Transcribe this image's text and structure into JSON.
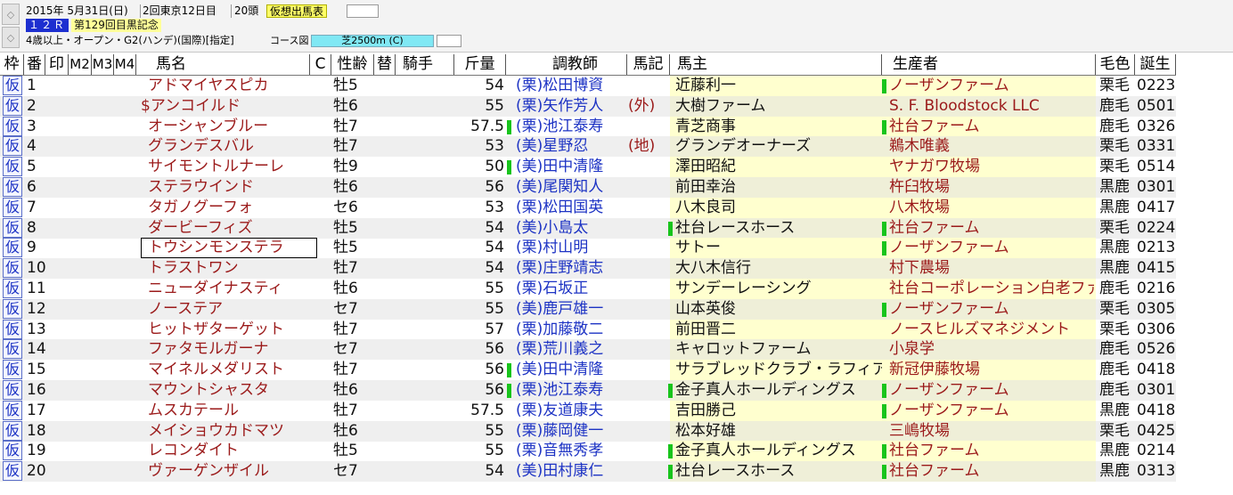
{
  "header": {
    "date": "2015年 5月31日(日)",
    "meeting": "2回東京12日目",
    "runners": "20頭",
    "mode_button": "仮想出馬表",
    "race_no": "１２Ｒ",
    "race_name": "第129回目黒記念",
    "conditions": "4歳以上・オープン・G2(ハンデ)(国際)[指定]",
    "course_label": "コース図",
    "course_value": "芝2500m (C)",
    "nav_up": "◇",
    "nav_down": "◇"
  },
  "columns": {
    "waku": "枠",
    "ban": "番",
    "shirushi": "印",
    "m2": "M2",
    "m3": "M3",
    "m4": "M4",
    "horse": "馬名",
    "c": "C",
    "sexage": "性齢",
    "kae": "替",
    "jockey": "騎手",
    "kinryo": "斤量",
    "trainer": "調教師",
    "umaki": "馬記",
    "owner": "馬主",
    "breeder": "生産者",
    "keiro": "毛色",
    "birth": "誕生"
  },
  "rows": [
    {
      "waku": "仮",
      "no": "1",
      "horse": "アドマイヤスピカ",
      "sexage": "牡5",
      "kinryo": "54",
      "trainer": "(栗)松田博資",
      "umaki": "",
      "owner": "近藤利一",
      "breeder": "ノーザンファーム",
      "keiro": "栗毛",
      "birth": "0223",
      "trainer_mark": false,
      "owner_mark": false,
      "breeder_mark": true,
      "breeder_color": "normal"
    },
    {
      "waku": "仮",
      "no": "2",
      "horse": "$アンコイルド",
      "sexage": "牡6",
      "kinryo": "55",
      "trainer": "(栗)矢作芳人",
      "umaki": "(外)",
      "owner": "大樹ファーム",
      "breeder": "S. F. Bloodstock LLC",
      "keiro": "鹿毛",
      "birth": "0501",
      "trainer_mark": false,
      "owner_mark": false,
      "breeder_mark": false,
      "breeder_color": "normal"
    },
    {
      "waku": "仮",
      "no": "3",
      "horse": "オーシャンブルー",
      "sexage": "牡7",
      "kinryo": "57.5",
      "trainer": "(栗)池江泰寿",
      "umaki": "",
      "owner": "青芝商事",
      "breeder": "社台ファーム",
      "keiro": "鹿毛",
      "birth": "0326",
      "trainer_mark": true,
      "owner_mark": false,
      "breeder_mark": true,
      "breeder_color": "normal"
    },
    {
      "waku": "仮",
      "no": "4",
      "horse": "グランデスバル",
      "sexage": "牡7",
      "kinryo": "53",
      "trainer": "(美)星野忍",
      "umaki": "(地)",
      "owner": "グランデオーナーズ",
      "breeder": "鵜木唯義",
      "keiro": "栗毛",
      "birth": "0331",
      "trainer_mark": false,
      "owner_mark": false,
      "breeder_mark": false,
      "breeder_color": "normal"
    },
    {
      "waku": "仮",
      "no": "5",
      "horse": "サイモントルナーレ",
      "sexage": "牡9",
      "kinryo": "50",
      "trainer": "(美)田中清隆",
      "umaki": "",
      "owner": "澤田昭紀",
      "breeder": "ヤナガワ牧場",
      "keiro": "栗毛",
      "birth": "0514",
      "trainer_mark": true,
      "owner_mark": false,
      "breeder_mark": false,
      "breeder_color": "normal"
    },
    {
      "waku": "仮",
      "no": "6",
      "horse": "ステラウインド",
      "sexage": "牡6",
      "kinryo": "56",
      "trainer": "(美)尾関知人",
      "umaki": "",
      "owner": "前田幸治",
      "breeder": "杵臼牧場",
      "keiro": "黒鹿",
      "birth": "0301",
      "trainer_mark": false,
      "owner_mark": false,
      "breeder_mark": false,
      "breeder_color": "normal"
    },
    {
      "waku": "仮",
      "no": "7",
      "horse": "タガノグーフォ",
      "sexage": "セ6",
      "kinryo": "53",
      "trainer": "(栗)松田国英",
      "umaki": "",
      "owner": "八木良司",
      "breeder": "八木牧場",
      "keiro": "黒鹿",
      "birth": "0417",
      "trainer_mark": false,
      "owner_mark": false,
      "breeder_mark": false,
      "breeder_color": "normal"
    },
    {
      "waku": "仮",
      "no": "8",
      "horse": "ダービーフィズ",
      "sexage": "牡5",
      "kinryo": "54",
      "trainer": "(美)小島太",
      "umaki": "",
      "owner": "社台レースホース",
      "breeder": "社台ファーム",
      "keiro": "栗毛",
      "birth": "0224",
      "trainer_mark": false,
      "owner_mark": true,
      "breeder_mark": true,
      "breeder_color": "normal"
    },
    {
      "waku": "仮",
      "no": "9",
      "horse": "トウシンモンステラ",
      "sexage": "牡5",
      "kinryo": "54",
      "trainer": "(栗)村山明",
      "umaki": "",
      "owner": "サトー",
      "breeder": "ノーザンファーム",
      "keiro": "黒鹿",
      "birth": "0213",
      "trainer_mark": false,
      "owner_mark": false,
      "breeder_mark": true,
      "breeder_color": "normal"
    },
    {
      "waku": "仮",
      "no": "10",
      "horse": "トラストワン",
      "sexage": "牡7",
      "kinryo": "54",
      "trainer": "(栗)庄野靖志",
      "umaki": "",
      "owner": "大八木信行",
      "breeder": "村下農場",
      "keiro": "黒鹿",
      "birth": "0415",
      "trainer_mark": false,
      "owner_mark": false,
      "breeder_mark": false,
      "breeder_color": "normal"
    },
    {
      "waku": "仮",
      "no": "11",
      "horse": "ニューダイナスティ",
      "sexage": "牡6",
      "kinryo": "55",
      "trainer": "(栗)石坂正",
      "umaki": "",
      "owner": "サンデーレーシング",
      "breeder": "社台コーポレーション白老ファー",
      "keiro": "鹿毛",
      "birth": "0216",
      "trainer_mark": false,
      "owner_mark": false,
      "breeder_mark": false,
      "breeder_color": "normal"
    },
    {
      "waku": "仮",
      "no": "12",
      "horse": "ノーステア",
      "sexage": "セ7",
      "kinryo": "55",
      "trainer": "(美)鹿戸雄一",
      "umaki": "",
      "owner": "山本英俊",
      "breeder": "ノーザンファーム",
      "keiro": "栗毛",
      "birth": "0305",
      "trainer_mark": false,
      "owner_mark": false,
      "breeder_mark": true,
      "breeder_color": "normal"
    },
    {
      "waku": "仮",
      "no": "13",
      "horse": "ヒットザターゲット",
      "sexage": "牡7",
      "kinryo": "57",
      "trainer": "(栗)加藤敬二",
      "umaki": "",
      "owner": "前田晋二",
      "breeder": "ノースヒルズマネジメント",
      "keiro": "栗毛",
      "birth": "0306",
      "trainer_mark": false,
      "owner_mark": false,
      "breeder_mark": false,
      "breeder_color": "normal"
    },
    {
      "waku": "仮",
      "no": "14",
      "horse": "ファタモルガーナ",
      "sexage": "セ7",
      "kinryo": "56",
      "trainer": "(栗)荒川義之",
      "umaki": "",
      "owner": "キャロットファーム",
      "breeder": "小泉学",
      "keiro": "鹿毛",
      "birth": "0526",
      "trainer_mark": false,
      "owner_mark": false,
      "breeder_mark": false,
      "breeder_color": "normal"
    },
    {
      "waku": "仮",
      "no": "15",
      "horse": "マイネルメダリスト",
      "sexage": "牡7",
      "kinryo": "56",
      "trainer": "(美)田中清隆",
      "umaki": "",
      "owner": "サラブレッドクラブ・ラフィアン",
      "breeder": "新冠伊藤牧場",
      "keiro": "鹿毛",
      "birth": "0418",
      "trainer_mark": true,
      "owner_mark": false,
      "breeder_mark": false,
      "breeder_color": "normal"
    },
    {
      "waku": "仮",
      "no": "16",
      "horse": "マウントシャスタ",
      "sexage": "牡6",
      "kinryo": "56",
      "trainer": "(栗)池江泰寿",
      "umaki": "",
      "owner": "金子真人ホールディングス",
      "breeder": "ノーザンファーム",
      "keiro": "鹿毛",
      "birth": "0301",
      "trainer_mark": true,
      "owner_mark": true,
      "breeder_mark": true,
      "breeder_color": "normal"
    },
    {
      "waku": "仮",
      "no": "17",
      "horse": "ムスカテール",
      "sexage": "牡7",
      "kinryo": "57.5",
      "trainer": "(栗)友道康夫",
      "umaki": "",
      "owner": "吉田勝己",
      "breeder": "ノーザンファーム",
      "keiro": "黒鹿",
      "birth": "0418",
      "trainer_mark": false,
      "owner_mark": false,
      "breeder_mark": true,
      "breeder_color": "normal"
    },
    {
      "waku": "仮",
      "no": "18",
      "horse": "メイショウカドマツ",
      "sexage": "牡6",
      "kinryo": "55",
      "trainer": "(栗)藤岡健一",
      "umaki": "",
      "owner": "松本好雄",
      "breeder": "三嶋牧場",
      "keiro": "栗毛",
      "birth": "0425",
      "trainer_mark": false,
      "owner_mark": false,
      "breeder_mark": false,
      "breeder_color": "normal"
    },
    {
      "waku": "仮",
      "no": "19",
      "horse": "レコンダイト",
      "sexage": "牡5",
      "kinryo": "55",
      "trainer": "(栗)音無秀孝",
      "umaki": "",
      "owner": "金子真人ホールディングス",
      "breeder": "社台ファーム",
      "keiro": "黒鹿",
      "birth": "0214",
      "trainer_mark": false,
      "owner_mark": true,
      "breeder_mark": true,
      "breeder_color": "normal"
    },
    {
      "waku": "仮",
      "no": "20",
      "horse": "ヴァーゲンザイル",
      "sexage": "セ7",
      "kinryo": "54",
      "trainer": "(美)田村康仁",
      "umaki": "",
      "owner": "社台レースホース",
      "breeder": "社台ファーム",
      "keiro": "黒鹿",
      "birth": "0313",
      "trainer_mark": false,
      "owner_mark": true,
      "breeder_mark": true,
      "breeder_color": "normal"
    }
  ],
  "selected_row": "9",
  "colors": {
    "accent_blue": "#1d2fd0",
    "horse_red": "#9b1a1a",
    "trainer_blue": "#1d33c4",
    "mark_green": "#18c41c",
    "yellow": "#ffff99",
    "course_cyan": "#80e8f4"
  }
}
